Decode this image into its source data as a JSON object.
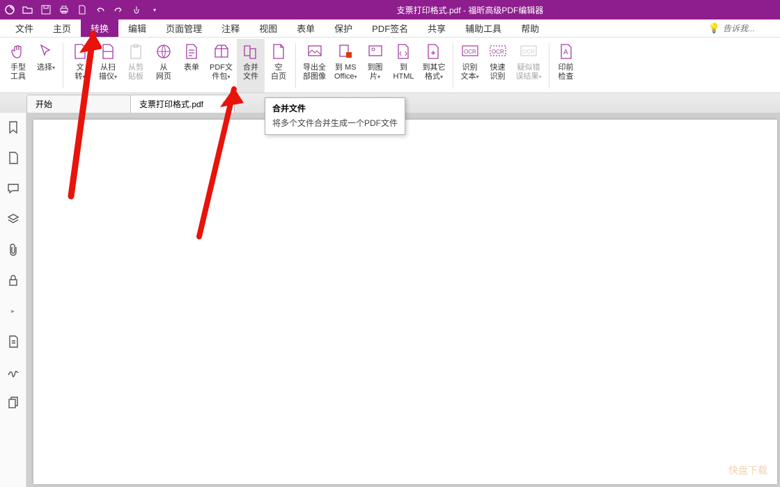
{
  "app": {
    "document_name": "支票打印格式.pdf",
    "app_name": "福昕高级PDF编辑器",
    "title_sep": " - "
  },
  "menus": {
    "file": "文件",
    "home": "主页",
    "convert": "转换",
    "edit": "编辑",
    "page_mgmt": "页面管理",
    "annotate": "注释",
    "view": "视图",
    "form": "表单",
    "protect": "保护",
    "pdf_sign": "PDF签名",
    "share": "共享",
    "aux_tools": "辅助工具",
    "help": "帮助"
  },
  "search": {
    "placeholder": "告诉我..."
  },
  "ribbon": {
    "hand_tool": "手型\n工具",
    "select": "选择",
    "file_convert": "文\n转",
    "from_scanner": "从扫\n描仪",
    "from_clipboard": "从剪\n贴板",
    "from_webpage": "从\n网页",
    "form_btn": "表单",
    "pdf_pack": "PDF文\n件包",
    "merge_files": "合并\n文件",
    "blank_page": "空\n白页",
    "export_all_images": "导出全\n部图像",
    "to_ms_office": "到 MS\nOffice",
    "to_image": "到图\n片",
    "to_html": "到\nHTML",
    "to_other_format": "到其它\n格式",
    "ocr_text": "识别\n文本",
    "quick_ocr": "快速\n识别",
    "ocr_suspect": "疑似错\n误结果",
    "preflight": "印前\n检查"
  },
  "tabs": {
    "start": "开始",
    "doc": "支票打印格式.pdf"
  },
  "tooltip": {
    "title": "合并文件",
    "body": "将多个文件合并生成一个PDF文件"
  },
  "watermark": "快盘下载"
}
